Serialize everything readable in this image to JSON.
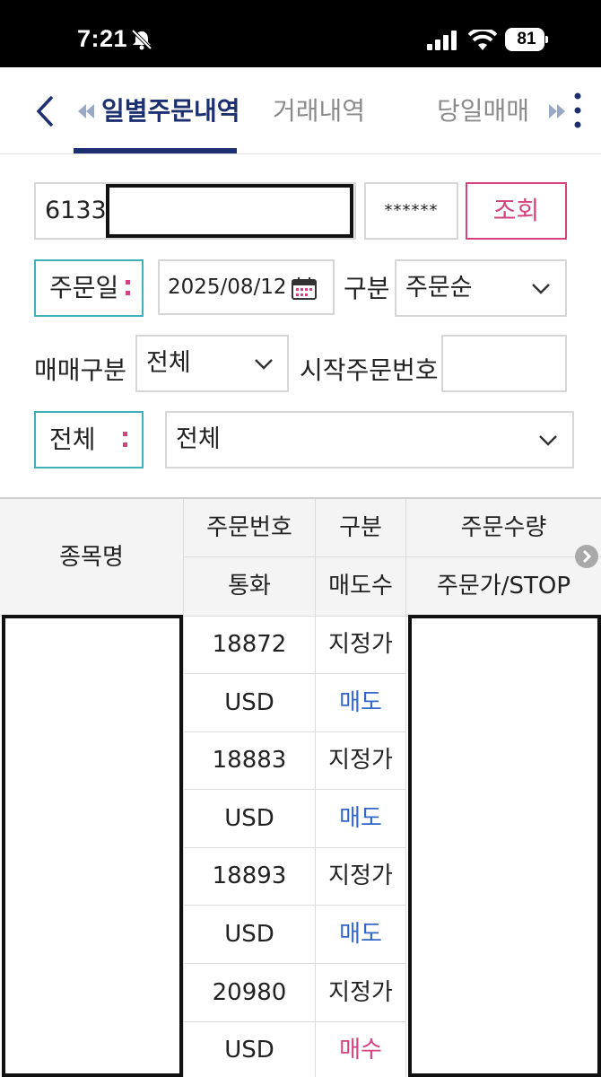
{
  "status_bar": {
    "time": "7:21",
    "battery": "81"
  },
  "tabs": {
    "items": [
      {
        "label": "일별주문내역",
        "active": true
      },
      {
        "label": "거래내역",
        "active": false
      },
      {
        "label": "당일매매",
        "active": false
      }
    ],
    "active_color": "#1c2f6e"
  },
  "form": {
    "account_prefix": "6133-",
    "password_mask": "******",
    "query_label": "조회",
    "order_date_label": "주문일",
    "date_value": "2025/08/12",
    "gubun_label": "구분",
    "sort_value": "주문순",
    "trade_type_label": "매매구분",
    "trade_type_value": "전체",
    "start_order_label": "시작주문번호",
    "start_order_value": "",
    "all_label": "전체",
    "all_select_value": "전체"
  },
  "table": {
    "headers": {
      "name": "종목명",
      "order_no": "주문번호",
      "gubun": "구분",
      "order_qty": "주문수량",
      "currency": "통화",
      "side": "매도수",
      "price": "주문가/STOP"
    },
    "rows": [
      {
        "order_no": "18872",
        "type": "지정가",
        "currency": "USD",
        "side": "매도"
      },
      {
        "order_no": "18883",
        "type": "지정가",
        "currency": "USD",
        "side": "매도"
      },
      {
        "order_no": "18893",
        "type": "지정가",
        "currency": "USD",
        "side": "매도"
      },
      {
        "order_no": "20980",
        "type": "지정가",
        "currency": "USD",
        "side": "매수"
      }
    ]
  },
  "colors": {
    "accent_pink": "#d3437f",
    "accent_teal": "#3fb0b7",
    "sell_blue": "#3266c8"
  }
}
